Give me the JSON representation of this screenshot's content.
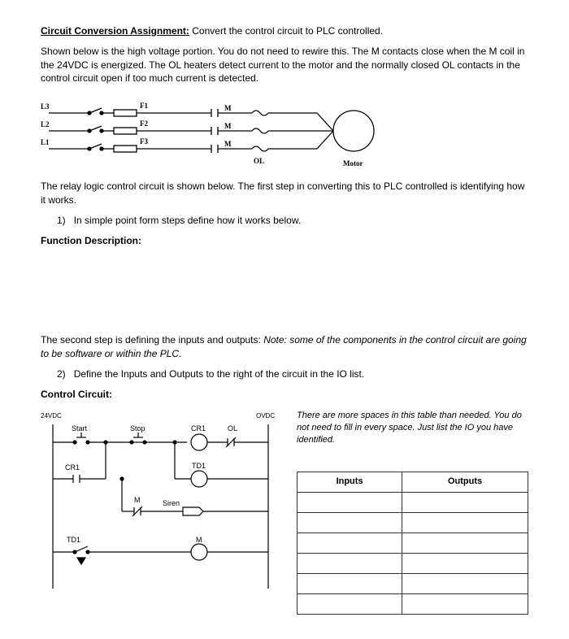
{
  "title": {
    "underlined": "Circuit Conversion Assignment:",
    "rest": "Convert the control circuit to PLC controlled."
  },
  "intro": "Shown below is the high voltage portion. You do not need to rewire this. The M contacts close when the M coil in the 24VDC is energized. The OL heaters detect current to the motor and the normally closed OL contacts in the control circuit open if too much current is detected.",
  "power": {
    "L3": "L3",
    "L2": "L2",
    "L1": "L1",
    "F1": "F1",
    "F2": "F2",
    "F3": "F3",
    "M": "M",
    "OL": "OL",
    "Motor": "Motor"
  },
  "mid1": "The relay logic control circuit is shown below. The first step in converting this to PLC controlled is identifying how it works.",
  "q1": "In simple point form steps define how it works below.",
  "funcdesc": "Function Description:",
  "mid2a": "The second step is defining the inputs and outputs: ",
  "mid2b": "Note: some of the components in the control circuit are going to be software or within the PLC.",
  "q2": "Define the Inputs and Outputs to the right of the circuit in the IO list.",
  "controlcircuit": "Control Circuit:",
  "ladder": {
    "vplus": "24VDC",
    "vneg": "OVDC",
    "Start": "Start",
    "Stop": "Stop",
    "CR1a": "CR1",
    "CR1b": "CR1",
    "TD1a": "TD1",
    "TD1b": "TD1",
    "OL": "OL",
    "Siren": "Siren",
    "Ma": "M",
    "Mcoil": "M"
  },
  "note": "There are more spaces in this table than needed. You do not need to fill in every space. Just list the IO you have identified.",
  "table": {
    "inputs": "Inputs",
    "outputs": "Outputs"
  },
  "list": {
    "n1": "1)",
    "n2": "2)"
  }
}
